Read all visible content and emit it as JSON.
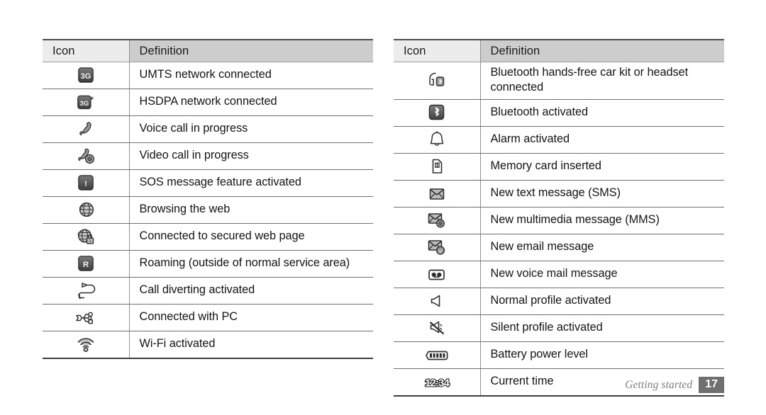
{
  "document": {
    "footer": {
      "section_label": "Getting started",
      "page_number": "17"
    }
  },
  "tables": {
    "left": {
      "headers": {
        "icon": "Icon",
        "definition": "Definition"
      },
      "rows": [
        {
          "icon_name": "umts-3g-icon",
          "icon_text": "3G",
          "definition": "UMTS network connected"
        },
        {
          "icon_name": "hsdpa-3g-plus-icon",
          "icon_text": "3G+",
          "definition": "HSDPA network connected"
        },
        {
          "icon_name": "voice-call-handset-icon",
          "icon_text": "",
          "definition": "Voice call in progress"
        },
        {
          "icon_name": "video-call-icon",
          "icon_text": "",
          "definition": "Video call in progress"
        },
        {
          "icon_name": "sos-message-icon",
          "icon_text": "!",
          "definition": "SOS message feature activated"
        },
        {
          "icon_name": "web-browsing-globe-icon",
          "icon_text": "",
          "definition": "Browsing the web"
        },
        {
          "icon_name": "secure-web-globe-lock-icon",
          "icon_text": "",
          "definition": "Connected to secured web page"
        },
        {
          "icon_name": "roaming-icon",
          "icon_text": "R",
          "definition": "Roaming (outside of normal service area)"
        },
        {
          "icon_name": "call-diverting-icon",
          "icon_text": "",
          "definition": "Call diverting activated"
        },
        {
          "icon_name": "usb-pc-connected-icon",
          "icon_text": "",
          "definition": "Connected with PC"
        },
        {
          "icon_name": "wifi-activated-icon",
          "icon_text": "",
          "definition": "Wi-Fi activated"
        }
      ]
    },
    "right": {
      "headers": {
        "icon": "Icon",
        "definition": "Definition"
      },
      "rows": [
        {
          "icon_name": "bluetooth-headset-icon",
          "icon_text": "",
          "definition": "Bluetooth hands-free car kit or headset connected",
          "tall": true
        },
        {
          "icon_name": "bluetooth-activated-icon",
          "icon_text": "",
          "definition": "Bluetooth activated"
        },
        {
          "icon_name": "alarm-bell-icon",
          "icon_text": "",
          "definition": "Alarm activated"
        },
        {
          "icon_name": "memory-card-icon",
          "icon_text": "",
          "definition": "Memory card inserted"
        },
        {
          "icon_name": "new-sms-envelope-icon",
          "icon_text": "",
          "definition": "New text message (SMS)"
        },
        {
          "icon_name": "new-mms-envelope-icon",
          "icon_text": "",
          "definition": "New multimedia message (MMS)"
        },
        {
          "icon_name": "new-email-envelope-icon",
          "icon_text": "",
          "definition": "New email message"
        },
        {
          "icon_name": "new-voicemail-icon",
          "icon_text": "",
          "definition": "New voice mail message"
        },
        {
          "icon_name": "normal-profile-speaker-icon",
          "icon_text": "",
          "definition": "Normal profile activated"
        },
        {
          "icon_name": "silent-profile-muted-icon",
          "icon_text": "",
          "definition": "Silent profile activated"
        },
        {
          "icon_name": "battery-level-icon",
          "icon_text": "",
          "definition": "Battery power level"
        },
        {
          "icon_name": "current-time-icon",
          "icon_text": "12:34",
          "definition": "Current time"
        }
      ]
    }
  },
  "colors": {
    "header_icon_bg": "#ececec",
    "header_def_bg": "#cdcdcd",
    "row_rule": "#6f6f6f",
    "page_num_bg": "#6f6f6f",
    "footer_text": "#7d7d7d",
    "icon_dark": "#4a4a4a",
    "text": "#141414"
  }
}
